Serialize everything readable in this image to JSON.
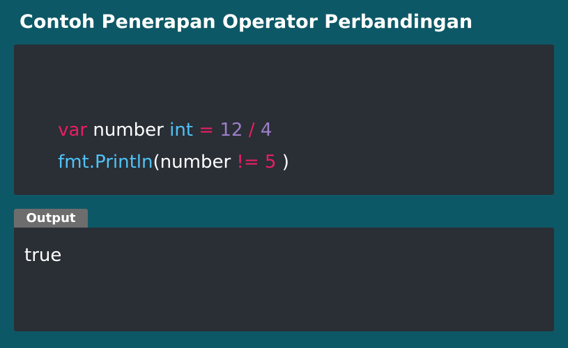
{
  "header": {
    "title": "Contoh Penerapan Operator Perbandingan"
  },
  "code": {
    "line1": [
      {
        "text": "var",
        "kind": "keyword"
      },
      {
        "text": " number ",
        "kind": "plain"
      },
      {
        "text": "int",
        "kind": "type"
      },
      {
        "text": " ",
        "kind": "plain"
      },
      {
        "text": "=",
        "kind": "operator"
      },
      {
        "text": " ",
        "kind": "plain"
      },
      {
        "text": "12",
        "kind": "number"
      },
      {
        "text": " ",
        "kind": "plain"
      },
      {
        "text": "/",
        "kind": "operator"
      },
      {
        "text": " ",
        "kind": "plain"
      },
      {
        "text": "4",
        "kind": "number"
      }
    ],
    "line2": [
      {
        "text": "fmt.Println",
        "kind": "function"
      },
      {
        "text": "(number ",
        "kind": "plain"
      },
      {
        "text": "!=",
        "kind": "operator"
      },
      {
        "text": " ",
        "kind": "plain"
      },
      {
        "text": "5",
        "kind": "keyword"
      },
      {
        "text": " )",
        "kind": "plain"
      }
    ]
  },
  "output": {
    "tab_label": "Output",
    "text": "true"
  },
  "colors": {
    "background": "#0d5866",
    "panel": "#2a2e35",
    "keyword": "#e91e63",
    "type": "#4fc3f7",
    "number": "#9c7fc9",
    "tab": "#6d6d6d"
  }
}
